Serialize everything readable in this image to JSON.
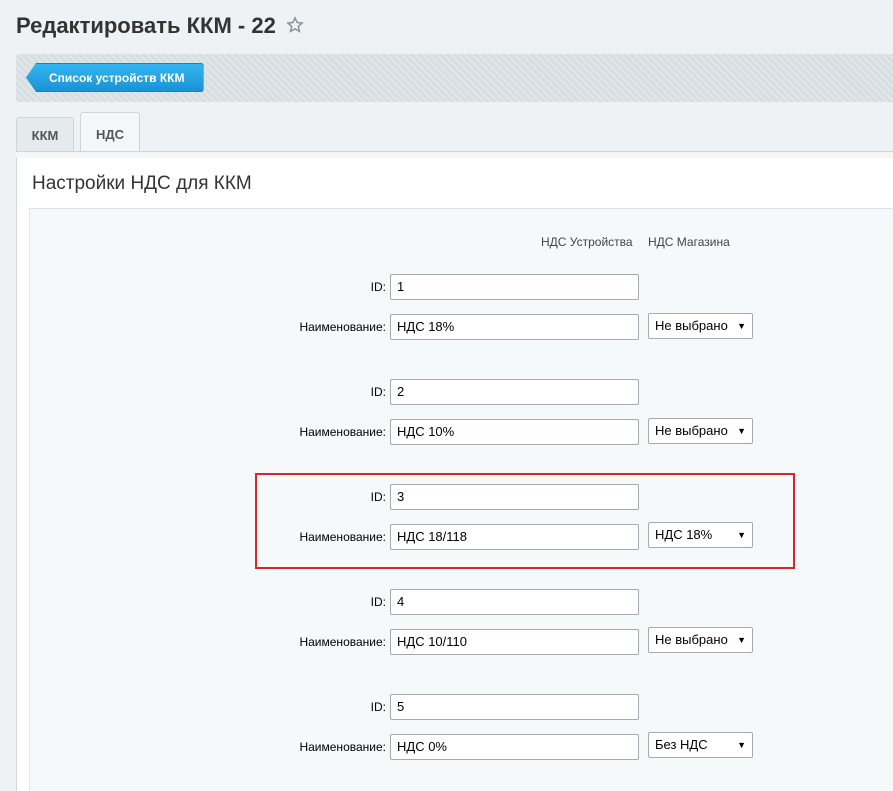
{
  "header": {
    "title": "Редактировать ККМ - 22"
  },
  "toolbar": {
    "list_button": "Список устройств ККМ"
  },
  "tabs": [
    {
      "label": "ККМ",
      "active": false
    },
    {
      "label": "НДС",
      "active": true
    }
  ],
  "section": {
    "title": "Настройки НДС для ККМ",
    "col_device": "НДС Устройства",
    "col_shop": "НДС Магазина"
  },
  "labels": {
    "id": "ID:",
    "name": "Наименование:"
  },
  "rows": [
    {
      "id": "1",
      "name": "НДС 18%",
      "shop": "Не выбрано"
    },
    {
      "id": "2",
      "name": "НДС 10%",
      "shop": "Не выбрано"
    },
    {
      "id": "3",
      "name": "НДС 18/118",
      "shop": "НДС 18%"
    },
    {
      "id": "4",
      "name": "НДС 10/110",
      "shop": "Не выбрано"
    },
    {
      "id": "5",
      "name": "НДС 0%",
      "shop": "Без НДС"
    }
  ],
  "colors": {
    "accent_button": "#1a92d6",
    "highlight_border": "#d9262c"
  },
  "icons": {
    "favorite": "star-outline-icon",
    "dropdown": "triangle-down-icon"
  }
}
